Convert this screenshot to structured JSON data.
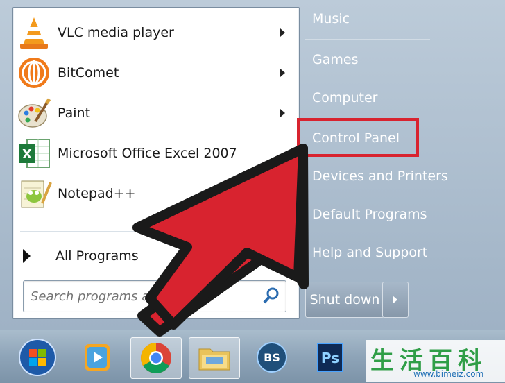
{
  "programs": [
    {
      "label": "VLC media player",
      "icon": "vlc-icon",
      "submenu": true
    },
    {
      "label": "BitComet",
      "icon": "bitcomet-icon",
      "submenu": true
    },
    {
      "label": "Paint",
      "icon": "paint-icon",
      "submenu": true
    },
    {
      "label": "Microsoft Office Excel 2007",
      "icon": "excel-icon",
      "submenu": false
    },
    {
      "label": "Notepad++",
      "icon": "notepadpp-icon",
      "submenu": false
    }
  ],
  "all_programs": "All Programs",
  "search": {
    "placeholder": "Search programs and files"
  },
  "right_pane": {
    "music": "Music",
    "games": "Games",
    "computer": "Computer",
    "control_panel": "Control Panel",
    "devices_printers": "Devices and Printers",
    "default_programs": "Default Programs",
    "help_support": "Help and Support"
  },
  "shutdown": {
    "label": "Shut down"
  },
  "taskbar": [
    "start-orb-icon",
    "media-player-icon",
    "chrome-icon",
    "explorer-folder-icon",
    "bbs-icon",
    "photoshop-icon"
  ],
  "photoshop_text": "Ps",
  "watermark": {
    "chinese": "生活百科",
    "url": "www.bimeiz.com"
  },
  "colors": {
    "highlight": "#d8232f",
    "arrow": "#d8232f"
  }
}
